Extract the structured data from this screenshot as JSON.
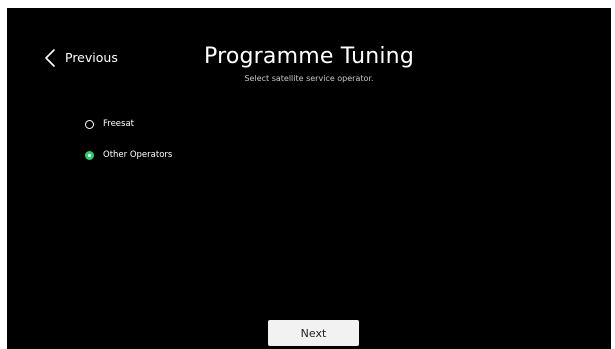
{
  "header": {
    "back_label": "Previous",
    "back_icon": "chevron-left-icon",
    "title": "Programme Tuning",
    "subtitle": "Select satellite service operator."
  },
  "options": [
    {
      "label": "Freesat",
      "selected": false
    },
    {
      "label": "Other Operators",
      "selected": true
    }
  ],
  "footer": {
    "next_label": "Next"
  },
  "colors": {
    "background": "#000000",
    "text": "#ffffff",
    "selected_radio": "#2ecc71",
    "button_background": "#f2f2f2",
    "button_text": "#222222"
  }
}
